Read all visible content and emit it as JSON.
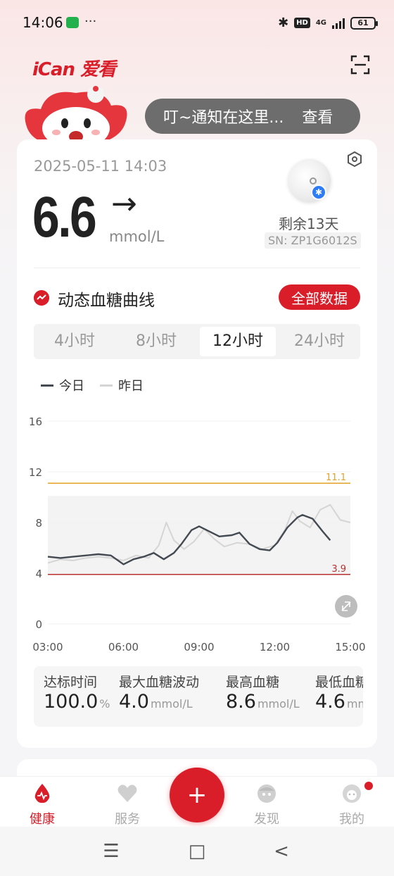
{
  "status_bar": {
    "time": "14:06",
    "dots": "···",
    "hd": "HD",
    "network": "4G",
    "battery": "61"
  },
  "header": {
    "brand": "iCan 爱看"
  },
  "notice": {
    "text": "叮~通知在这里...",
    "action": "查看"
  },
  "reading": {
    "timestamp": "2025-05-11 14:03",
    "value": "6.6",
    "arrow": "→",
    "unit": "mmol/L"
  },
  "sensor": {
    "remaining": "剩余13天",
    "sn": "SN: ZP1G6012S"
  },
  "curve": {
    "title": "动态血糖曲线",
    "all_data_button": "全部数据",
    "tabs": [
      "4小时",
      "8小时",
      "12小时",
      "24小时"
    ],
    "active_tab": "12小时",
    "legend_today": "今日",
    "legend_yesterday": "昨日"
  },
  "chart_data": {
    "type": "line",
    "x_ticks": [
      "03:00",
      "06:00",
      "09:00",
      "12:00",
      "15:00"
    ],
    "y_ticks": [
      "0",
      "4",
      "8",
      "12",
      "16"
    ],
    "ylim": [
      0,
      16
    ],
    "xlim_hours": [
      3,
      15
    ],
    "target_range": [
      3.9,
      11.1
    ],
    "threshold_labels": {
      "high": "11.1",
      "low": "3.9"
    },
    "colors": {
      "today": "#444a52",
      "yesterday": "#d5d5d5",
      "high": "#e3a22a",
      "low": "#b8312f"
    },
    "series": [
      {
        "name": "今日",
        "points": [
          [
            3.0,
            5.3
          ],
          [
            3.5,
            5.2
          ],
          [
            4.0,
            5.3
          ],
          [
            4.5,
            5.4
          ],
          [
            5.0,
            5.5
          ],
          [
            5.5,
            5.4
          ],
          [
            6.0,
            4.7
          ],
          [
            6.4,
            5.1
          ],
          [
            6.8,
            5.3
          ],
          [
            7.2,
            5.6
          ],
          [
            7.6,
            5.1
          ],
          [
            8.0,
            5.6
          ],
          [
            8.3,
            6.3
          ],
          [
            8.7,
            7.4
          ],
          [
            9.0,
            7.7
          ],
          [
            9.4,
            7.3
          ],
          [
            9.8,
            6.9
          ],
          [
            10.3,
            7.0
          ],
          [
            10.6,
            7.2
          ],
          [
            11.0,
            6.3
          ],
          [
            11.4,
            5.9
          ],
          [
            11.8,
            5.8
          ],
          [
            12.1,
            6.4
          ],
          [
            12.5,
            7.6
          ],
          [
            12.9,
            8.4
          ],
          [
            13.1,
            8.6
          ],
          [
            13.5,
            8.3
          ],
          [
            13.9,
            7.3
          ],
          [
            14.2,
            6.6
          ]
        ]
      },
      {
        "name": "昨日",
        "points": [
          [
            3.0,
            4.8
          ],
          [
            3.5,
            5.1
          ],
          [
            4.0,
            5.0
          ],
          [
            4.5,
            5.2
          ],
          [
            5.0,
            5.3
          ],
          [
            5.5,
            5.2
          ],
          [
            6.0,
            5.0
          ],
          [
            6.5,
            5.4
          ],
          [
            7.0,
            5.2
          ],
          [
            7.4,
            6.2
          ],
          [
            7.7,
            8.0
          ],
          [
            8.0,
            6.6
          ],
          [
            8.4,
            5.9
          ],
          [
            8.8,
            6.5
          ],
          [
            9.2,
            7.5
          ],
          [
            9.6,
            6.7
          ],
          [
            10.0,
            6.1
          ],
          [
            10.5,
            6.4
          ],
          [
            11.0,
            6.3
          ],
          [
            11.5,
            5.9
          ],
          [
            12.0,
            6.2
          ],
          [
            12.4,
            7.4
          ],
          [
            12.7,
            8.9
          ],
          [
            13.0,
            8.1
          ],
          [
            13.4,
            7.6
          ],
          [
            13.8,
            9.0
          ],
          [
            14.2,
            9.4
          ],
          [
            14.6,
            8.2
          ],
          [
            15.0,
            8.0
          ]
        ]
      }
    ]
  },
  "stats": [
    {
      "label": "达标时间",
      "value": "100.0",
      "unit": "%"
    },
    {
      "label": "最大血糖波动",
      "value": "4.0",
      "unit": "mmol/L"
    },
    {
      "label": "最高血糖",
      "value": "8.6",
      "unit": "mmol/L"
    },
    {
      "label": "最低血糖",
      "value": "4.6",
      "unit": "mmol/L"
    }
  ],
  "tabbar": {
    "health": "健康",
    "service": "服务",
    "discover": "发现",
    "mine": "我的",
    "add": "+"
  },
  "navbar": {
    "menu": "☰",
    "home": "□",
    "back": "<"
  }
}
